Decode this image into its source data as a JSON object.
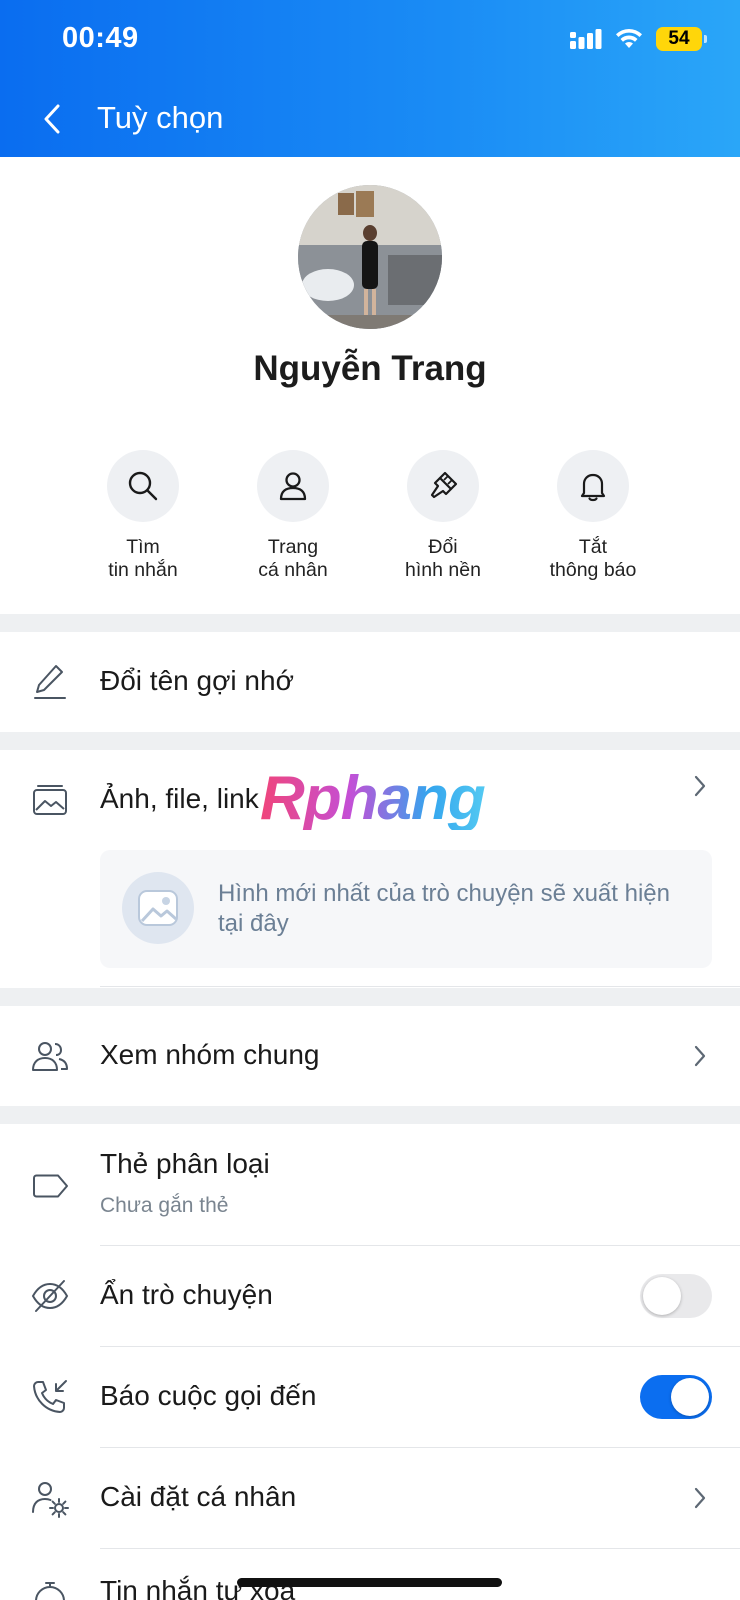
{
  "status_bar": {
    "time": "00:49",
    "battery": "54"
  },
  "header": {
    "title": "Tuỳ chọn"
  },
  "profile": {
    "name": "Nguyễn Trang"
  },
  "actions": [
    {
      "label": "Tìm\ntin nhắn",
      "icon": "search-icon"
    },
    {
      "label": "Trang\ncá nhân",
      "icon": "person-icon"
    },
    {
      "label": "Đổi\nhình nền",
      "icon": "paint-brush-icon"
    },
    {
      "label": "Tắt\nthông báo",
      "icon": "bell-icon"
    }
  ],
  "menu": {
    "rename": {
      "label": "Đổi tên gợi nhớ",
      "icon": "pencil-icon"
    },
    "media": {
      "label": "Ảnh, file, link",
      "icon": "photo-album-icon",
      "placeholder": "Hình mới nhất của trò chuyện sẽ xuất hiện tại đây"
    },
    "common_groups": {
      "label": "Xem nhóm chung",
      "icon": "group-icon"
    },
    "tag": {
      "label": "Thẻ phân loại",
      "sub": "Chưa gắn thẻ",
      "icon": "tag-icon"
    },
    "hide_chat": {
      "label": "Ẩn trò chuyện",
      "icon": "eye-off-icon",
      "enabled": false
    },
    "incoming_call": {
      "label": "Báo cuộc gọi đến",
      "icon": "incoming-call-icon",
      "enabled": true
    },
    "personal_settings": {
      "label": "Cài đặt cá nhân",
      "icon": "user-settings-icon"
    },
    "auto_delete": {
      "label": "Tin nhắn tự xóa",
      "icon": "timer-icon"
    }
  },
  "watermark": "Rphang",
  "colors": {
    "header_start": "#0a6df0",
    "header_end": "#2aa6f8",
    "toggle_on": "#0b6ef0",
    "battery": "#ffd60a"
  }
}
